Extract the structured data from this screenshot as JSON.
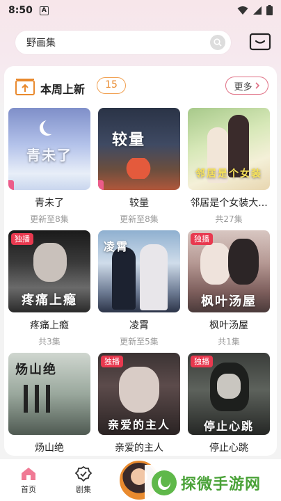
{
  "status": {
    "time": "8:50",
    "a_icon": "A"
  },
  "search": {
    "value": "野画集"
  },
  "section": {
    "title": "本周上新",
    "count": "15",
    "more_label": "更多"
  },
  "items": [
    {
      "title": "青未了",
      "sub": "更新至8集",
      "tag": "",
      "art": "青未了"
    },
    {
      "title": "较量",
      "sub": "更新至8集",
      "tag": "",
      "art": "较量"
    },
    {
      "title": "邻居是个女装大...",
      "sub": "共27集",
      "tag": "",
      "art": "邻居是个女装"
    },
    {
      "title": "疼痛上瘾",
      "sub": "共3集",
      "tag": "独播",
      "art": "疼痛上瘾"
    },
    {
      "title": "凌霄",
      "sub": "更新至5集",
      "tag": "",
      "art": "凌霄"
    },
    {
      "title": "枫叶汤屋",
      "sub": "共1集",
      "tag": "独播",
      "art": "枫叶汤屋"
    },
    {
      "title": "炀山绝",
      "sub": "",
      "tag": "",
      "art": "炀山绝"
    },
    {
      "title": "亲爱的主人",
      "sub": "",
      "tag": "独播",
      "art": "亲爱的主人"
    },
    {
      "title": "停止心跳",
      "sub": "",
      "tag": "独播",
      "art": "停止心跳"
    }
  ],
  "nav": {
    "home": "首页",
    "drama": "剧集"
  },
  "watermark": {
    "text": "探微手游网"
  },
  "colors": {
    "accent": "#e8394f",
    "badge": "#e98a2e",
    "more_border": "#e07085"
  }
}
